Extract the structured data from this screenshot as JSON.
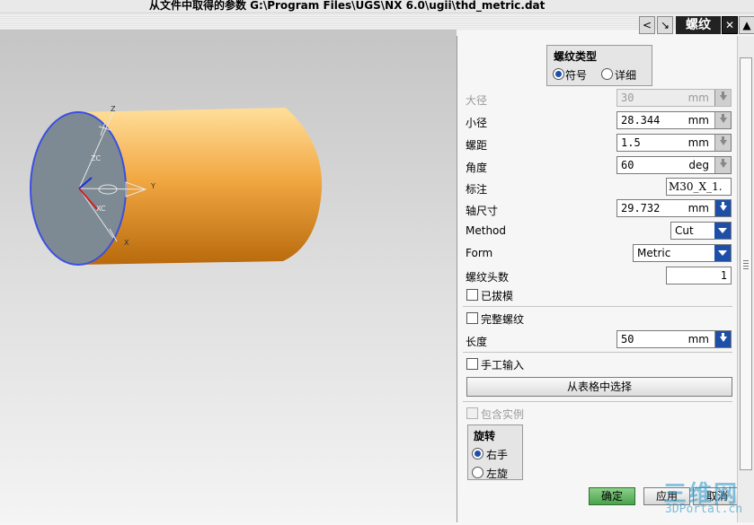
{
  "status_bar": {
    "text": "从文件中取得的参数 G:\\Program Files\\UGS\\NX 6.0\\ugii\\thd_metric.dat"
  },
  "titlebar": {
    "title": "螺纹",
    "nav_left": "<",
    "close": "✕"
  },
  "viewport": {
    "axis_labels": {
      "z": "Z",
      "zc": "ZC",
      "xc": "XC",
      "x": "X",
      "y": "Y"
    },
    "colors": {
      "cylinder_light": "#ffd27a",
      "cylinder_dark": "#c07410",
      "face": "#7d8a94",
      "edge": "#3a4fe0"
    }
  },
  "thread_type": {
    "title": "螺纹类型",
    "options": [
      "符号",
      "详细"
    ],
    "selected": "符号"
  },
  "fields": {
    "major_diameter": {
      "label": "大径",
      "value": "30",
      "unit": "mm",
      "enabled": false
    },
    "minor_diameter": {
      "label": "小径",
      "value": "28.344",
      "unit": "mm"
    },
    "pitch": {
      "label": "螺距",
      "value": "1.5",
      "unit": "mm"
    },
    "angle": {
      "label": "角度",
      "value": "60",
      "unit": "deg"
    },
    "callout": {
      "label": "标注",
      "value": "M30_X_1."
    },
    "shaft_size": {
      "label": "轴尺寸",
      "value": "29.732",
      "unit": "mm"
    },
    "method": {
      "label": "Method",
      "value": "Cut"
    },
    "form": {
      "label": "Form",
      "value": "Metric"
    },
    "num_starts": {
      "label": "螺纹头数",
      "value": "1"
    },
    "tapered": {
      "label": "已拔模",
      "checked": false
    },
    "full_thread": {
      "label": "完整螺纹",
      "checked": false
    },
    "length": {
      "label": "长度",
      "value": "50",
      "unit": "mm"
    },
    "manual_input": {
      "label": "手工输入",
      "checked": false
    },
    "choose_from_table": {
      "label": "从表格中选择"
    },
    "include_instances": {
      "label": "包含实例",
      "checked": false,
      "enabled": false
    }
  },
  "rotation": {
    "title": "旋转",
    "options": [
      "右手",
      "左旋"
    ],
    "selected": "右手"
  },
  "buttons": {
    "ok": "确定",
    "apply": "应用",
    "cancel": "取消"
  },
  "watermark": {
    "line1": "三维网",
    "line2": "3DPortal.cn"
  }
}
